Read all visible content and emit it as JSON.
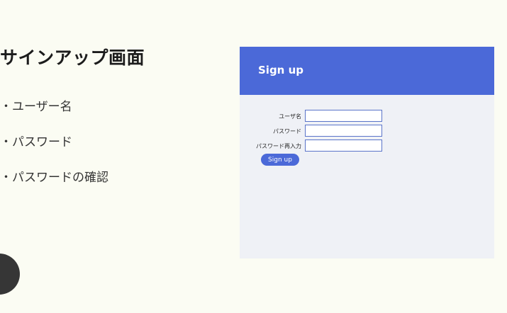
{
  "slide": {
    "title": "サインアップ画面",
    "bullets": [
      "・ユーザー名",
      "・パスワード",
      "・パスワードの確認"
    ]
  },
  "mock": {
    "header_title": "Sign up",
    "fields": [
      {
        "label": "ユーザ名",
        "value": ""
      },
      {
        "label": "パスワード",
        "value": ""
      },
      {
        "label": "パスワード再入力",
        "value": ""
      }
    ],
    "button_label": "Sign up",
    "colors": {
      "accent": "#4b69d8",
      "panel": "#eff1f6"
    }
  }
}
